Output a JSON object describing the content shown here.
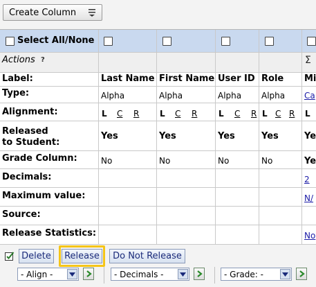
{
  "toolbar": {
    "create_column_label": "Create Column"
  },
  "header": {
    "select_all_label": "Select All/None",
    "actions_label": "Actions"
  },
  "row_labels": {
    "label": "Label:",
    "type": "Type:",
    "alignment": "Alignment:",
    "released_line1": "Released",
    "released_line2": "to Student:",
    "grade_column": "Grade Column:",
    "decimals": "Decimals:",
    "maximum_value": "Maximum value:",
    "source": "Source:",
    "release_statistics": "Release Statistics:"
  },
  "columns": [
    {
      "label": "Last Name",
      "type": "Alpha",
      "align": [
        "L",
        "C",
        "R"
      ],
      "released": "Yes",
      "grade_column": "No"
    },
    {
      "label": "First Name",
      "type": "Alpha",
      "align": [
        "L",
        "C",
        "R"
      ],
      "released": "Yes",
      "grade_column": "No"
    },
    {
      "label": "User ID",
      "type": "Alpha",
      "align": [
        "L",
        "C",
        "R"
      ],
      "released": "Yes",
      "grade_column": "No"
    },
    {
      "label": "Role",
      "type": "Alpha",
      "align": [
        "L",
        "C",
        "R"
      ],
      "released": "Yes",
      "grade_column": "No"
    },
    {
      "label": "Mi",
      "type": "Ca",
      "align": [
        "L"
      ],
      "released": "Ye",
      "grade_column": "Ye",
      "decimals": "2",
      "maximum_value": "N/",
      "release_statistics": "No"
    }
  ],
  "bottom": {
    "delete_label": "Delete",
    "release_label": "Release",
    "do_not_release_label": "Do Not Release",
    "align_select": "- Align -",
    "decimals_select": "- Decimals -",
    "grade_select": "- Grade: -"
  },
  "colors": {
    "header_band": "#c9d9ef",
    "highlight": "#f5c518",
    "link": "#1a1aa6"
  }
}
